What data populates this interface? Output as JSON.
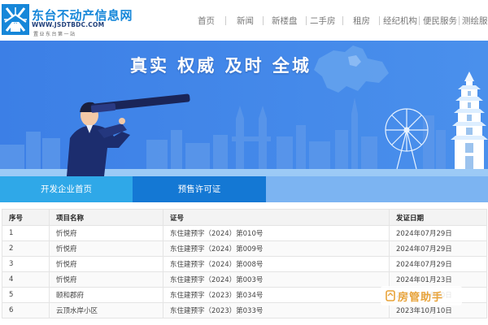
{
  "site": {
    "title": "东台不动产信息网",
    "url": "WWW.JSDTBDC.COM",
    "slogan": "置业东台第一站"
  },
  "nav": {
    "items": [
      "首页",
      "新闻",
      "新楼盘",
      "二手房",
      "租房",
      "经纪机构",
      "便民服务",
      "测绘服务"
    ]
  },
  "banner": {
    "headline": "真实 权威 及时 全城"
  },
  "tabs": [
    {
      "label": "开发企业首页",
      "active": false
    },
    {
      "label": "预售许可证",
      "active": true
    }
  ],
  "table": {
    "headers": [
      "序号",
      "项目名称",
      "证号",
      "发证日期"
    ],
    "rows": [
      [
        "1",
        "忻悦府",
        "东住建预字（2024）第010号",
        "2024年07月29日"
      ],
      [
        "2",
        "忻悦府",
        "东住建预字（2024）第009号",
        "2024年07月29日"
      ],
      [
        "3",
        "忻悦府",
        "东住建预字（2024）第008号",
        "2024年07月29日"
      ],
      [
        "4",
        "忻悦府",
        "东住建预字（2024）第003号",
        "2024年01月23日"
      ],
      [
        "5",
        "颐和郡府",
        "东住建预字（2023）第034号",
        "2023年10月10日"
      ],
      [
        "6",
        "云顶水岸小区",
        "东住建预字（2023）第033号",
        "2023年10月10日"
      ]
    ]
  },
  "watermark": {
    "text": "房管助手",
    "icon": "house-icon"
  },
  "colors": {
    "brand": "#1687d9",
    "banner": "#3d83e8",
    "tab_active": "#1478d4",
    "tab_home": "#2fa8e8",
    "tab_bar": "#7cb4f2",
    "watermark": "#e8a33a"
  }
}
